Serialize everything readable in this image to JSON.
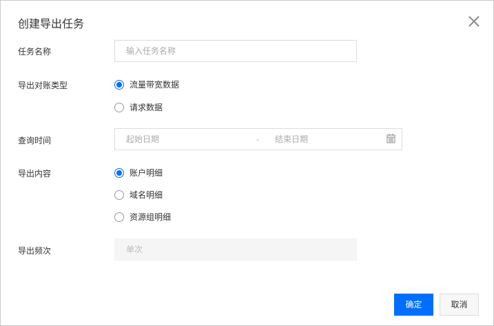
{
  "title": "创建导出任务",
  "fields": {
    "task_name": {
      "label": "任务名称",
      "placeholder": "输入任务名称"
    },
    "type": {
      "label": "导出对账类型",
      "options": [
        {
          "label": "流量带宽数据",
          "selected": true
        },
        {
          "label": "请求数据",
          "selected": false
        }
      ]
    },
    "time": {
      "label": "查询时间",
      "start_placeholder": "起始日期",
      "separator": "-",
      "end_placeholder": "结束日期"
    },
    "content": {
      "label": "导出内容",
      "options": [
        {
          "label": "账户明细",
          "selected": true
        },
        {
          "label": "域名明细",
          "selected": false
        },
        {
          "label": "资源组明细",
          "selected": false
        }
      ]
    },
    "frequency": {
      "label": "导出频次",
      "value": "单次"
    }
  },
  "buttons": {
    "confirm": "确定",
    "cancel": "取消"
  }
}
